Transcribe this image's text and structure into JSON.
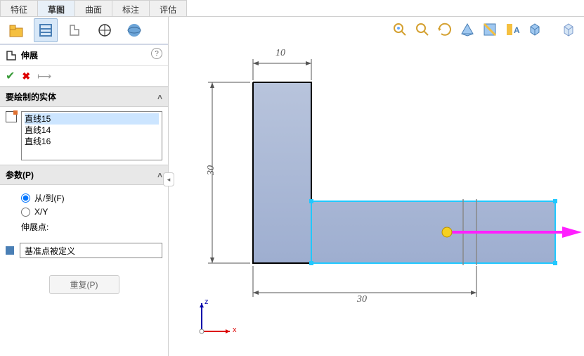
{
  "tabs": {
    "t0": "特征",
    "t1": "草图",
    "t2": "曲面",
    "t3": "标注",
    "t4": "评估"
  },
  "title": "伸展",
  "sections": {
    "entities": "要绘制的实体",
    "params": "参数(P)"
  },
  "entity_list": [
    "直线15",
    "直线14",
    "直线16"
  ],
  "radios": {
    "fromto": "从/到(F)",
    "xy": "X/Y"
  },
  "labels": {
    "extend_point": "伸展点:",
    "base_def": "基准点被定义",
    "repeat": "重复(P)",
    "help": "?"
  },
  "dims": {
    "top": "10",
    "left": "30",
    "bottom": "30"
  },
  "axes": {
    "x": "x",
    "z": "z"
  }
}
